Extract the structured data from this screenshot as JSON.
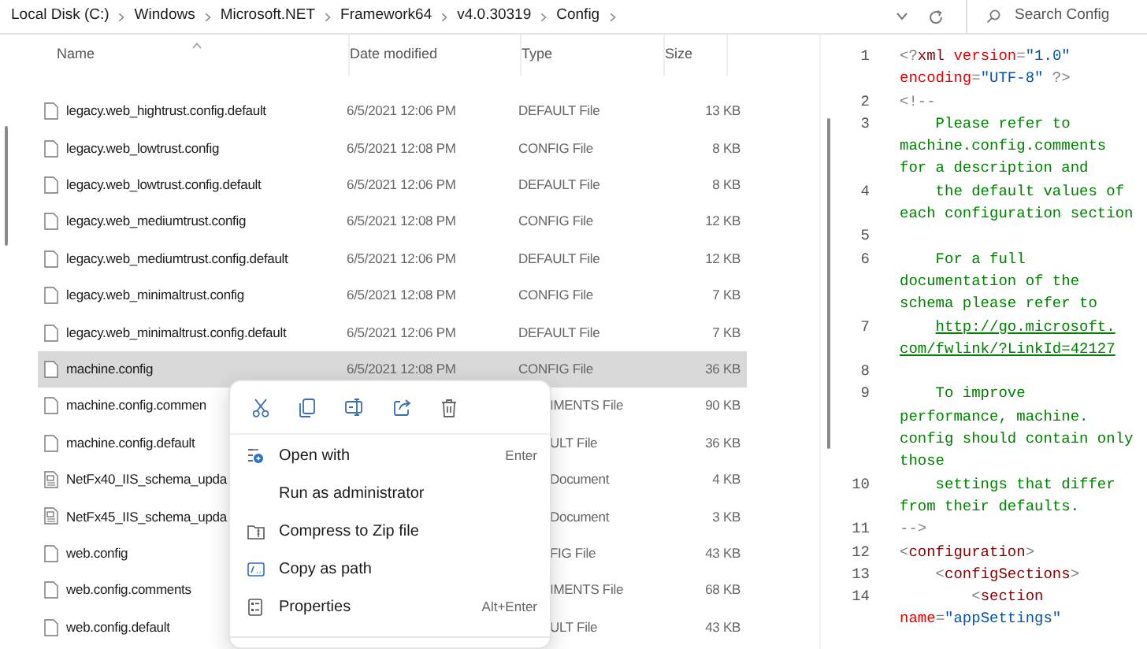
{
  "breadcrumb": [
    "Local Disk (C:)",
    "Windows",
    "Microsoft.NET",
    "Framework64",
    "v4.0.30319",
    "Config"
  ],
  "search": {
    "placeholder": "Search Config"
  },
  "columns": [
    "Name",
    "Date modified",
    "Type",
    "Size"
  ],
  "files": [
    {
      "name": "legacy.web_hightrust.config.default",
      "date": "6/5/2021 12:06 PM",
      "type": "DEFAULT File",
      "size": "13 KB",
      "kind": "file",
      "selected": false
    },
    {
      "name": "legacy.web_lowtrust.config",
      "date": "6/5/2021 12:08 PM",
      "type": "CONFIG File",
      "size": "8 KB",
      "kind": "file",
      "selected": false
    },
    {
      "name": "legacy.web_lowtrust.config.default",
      "date": "6/5/2021 12:06 PM",
      "type": "DEFAULT File",
      "size": "8 KB",
      "kind": "file",
      "selected": false
    },
    {
      "name": "legacy.web_mediumtrust.config",
      "date": "6/5/2021 12:08 PM",
      "type": "CONFIG File",
      "size": "12 KB",
      "kind": "file",
      "selected": false
    },
    {
      "name": "legacy.web_mediumtrust.config.default",
      "date": "6/5/2021 12:06 PM",
      "type": "DEFAULT File",
      "size": "12 KB",
      "kind": "file",
      "selected": false
    },
    {
      "name": "legacy.web_minimaltrust.config",
      "date": "6/5/2021 12:08 PM",
      "type": "CONFIG File",
      "size": "7 KB",
      "kind": "file",
      "selected": false
    },
    {
      "name": "legacy.web_minimaltrust.config.default",
      "date": "6/5/2021 12:06 PM",
      "type": "DEFAULT File",
      "size": "7 KB",
      "kind": "file",
      "selected": false
    },
    {
      "name": "machine.config",
      "date": "6/5/2021 12:08 PM",
      "type": "CONFIG File",
      "size": "36 KB",
      "kind": "file",
      "selected": true
    },
    {
      "name": "machine.config.commen",
      "type": "IMENTS File",
      "size": "90 KB",
      "kind": "file",
      "selected": false,
      "partly_hidden": true
    },
    {
      "name": "machine.config.default",
      "type": "ULT File",
      "size": "36 KB",
      "kind": "file",
      "selected": false,
      "partly_hidden": true
    },
    {
      "name": "NetFx40_IIS_schema_upda",
      "type": "Document",
      "size": "4 KB",
      "kind": "document",
      "selected": false,
      "partly_hidden": true
    },
    {
      "name": "NetFx45_IIS_schema_upda",
      "type": "Document",
      "size": "3 KB",
      "kind": "document",
      "selected": false,
      "partly_hidden": true
    },
    {
      "name": "web.config",
      "type": "FIG File",
      "size": "43 KB",
      "kind": "file",
      "selected": false,
      "partly_hidden": true
    },
    {
      "name": "web.config.comments",
      "type": "IMENTS File",
      "size": "68 KB",
      "kind": "file",
      "selected": false,
      "partly_hidden": true
    },
    {
      "name": "web.config.default",
      "type": "ULT File",
      "size": "43 KB",
      "kind": "file",
      "selected": false,
      "partly_hidden": true
    }
  ],
  "context_menu": {
    "items": [
      {
        "label": "Open with",
        "shortcut": "Enter",
        "kind": "open-with"
      },
      {
        "label": "Run as administrator",
        "kind": "plain"
      },
      {
        "label": "Compress to Zip file",
        "kind": "zip"
      },
      {
        "label": "Copy as path",
        "kind": "path"
      },
      {
        "label": "Properties",
        "shortcut": "Alt+Enter",
        "kind": "properties"
      }
    ]
  },
  "preview": {
    "lines": [
      {
        "number": "1",
        "rows": [
          {
            "tokens": [
              {
                "kind": "delim",
                "text": "<?"
              },
              {
                "kind": "tag",
                "text": "xml "
              },
              {
                "kind": "attr",
                "text": "version"
              },
              {
                "kind": "delim",
                "text": "="
              },
              {
                "kind": "value",
                "text": "\"1.0\""
              }
            ]
          },
          {
            "tokens": [
              {
                "kind": "attr",
                "text": "encoding"
              },
              {
                "kind": "delim",
                "text": "="
              },
              {
                "kind": "value",
                "text": "\"UTF-8\" "
              },
              {
                "kind": "delim",
                "text": "?>"
              }
            ]
          }
        ]
      },
      {
        "number": "2",
        "rows": [
          {
            "tokens": [
              {
                "kind": "delim",
                "text": "<!--"
              }
            ]
          }
        ]
      },
      {
        "number": "3",
        "rows": [
          {
            "tokens": [
              {
                "kind": "comment",
                "text": "    Please refer to"
              }
            ]
          },
          {
            "tokens": [
              {
                "kind": "comment",
                "text": "machine.config.comments"
              }
            ]
          },
          {
            "tokens": [
              {
                "kind": "comment",
                "text": "for a description and"
              }
            ]
          }
        ]
      },
      {
        "number": "4",
        "rows": [
          {
            "tokens": [
              {
                "kind": "comment",
                "text": "    the default values of"
              }
            ]
          },
          {
            "tokens": [
              {
                "kind": "comment",
                "text": "each configuration section"
              }
            ]
          }
        ]
      },
      {
        "number": "5"
      },
      {
        "number": "6",
        "rows": [
          {
            "tokens": [
              {
                "kind": "comment",
                "text": "    For a full"
              }
            ]
          },
          {
            "tokens": [
              {
                "kind": "comment",
                "text": "documentation of the"
              }
            ]
          },
          {
            "tokens": [
              {
                "kind": "comment",
                "text": "schema please refer to"
              }
            ]
          }
        ]
      },
      {
        "number": "7",
        "rows": [
          {
            "indented": true,
            "tokens": [
              {
                "kind": "link",
                "text": "http://go.microsoft."
              }
            ]
          },
          {
            "tokens": [
              {
                "kind": "link",
                "text": "com/fwlink/?LinkId=42127"
              }
            ]
          }
        ]
      },
      {
        "number": "8"
      },
      {
        "number": "9",
        "rows": [
          {
            "tokens": [
              {
                "kind": "comment",
                "text": "    To improve"
              }
            ]
          },
          {
            "tokens": [
              {
                "kind": "comment",
                "text": "performance, machine."
              }
            ]
          },
          {
            "tokens": [
              {
                "kind": "comment",
                "text": "config should contain only"
              }
            ]
          },
          {
            "tokens": [
              {
                "kind": "comment",
                "text": "those"
              }
            ]
          }
        ]
      },
      {
        "number": "10",
        "rows": [
          {
            "tokens": [
              {
                "kind": "comment",
                "text": "    settings that differ"
              }
            ]
          },
          {
            "tokens": [
              {
                "kind": "comment",
                "text": "from their defaults."
              }
            ]
          }
        ]
      },
      {
        "number": "11",
        "rows": [
          {
            "tokens": [
              {
                "kind": "delim",
                "text": "-->"
              }
            ]
          }
        ]
      },
      {
        "number": "12",
        "rows": [
          {
            "tokens": [
              {
                "kind": "delim",
                "text": "<"
              },
              {
                "kind": "tag",
                "text": "configuration"
              },
              {
                "kind": "delim",
                "text": ">"
              }
            ]
          }
        ]
      },
      {
        "number": "13",
        "rows": [
          {
            "tokens": [
              {
                "kind": "delim",
                "text": "    <"
              },
              {
                "kind": "tag",
                "text": "configSections"
              },
              {
                "kind": "delim",
                "text": ">"
              }
            ]
          }
        ]
      },
      {
        "number": "14",
        "rows": [
          {
            "tokens": [
              {
                "kind": "delim",
                "text": "        <"
              },
              {
                "kind": "tag",
                "text": "section"
              }
            ]
          },
          {
            "tokens": [
              {
                "kind": "attr",
                "text": "name"
              },
              {
                "kind": "delim",
                "text": "="
              },
              {
                "kind": "value",
                "text": "\"appSettings\""
              }
            ]
          }
        ]
      }
    ]
  }
}
